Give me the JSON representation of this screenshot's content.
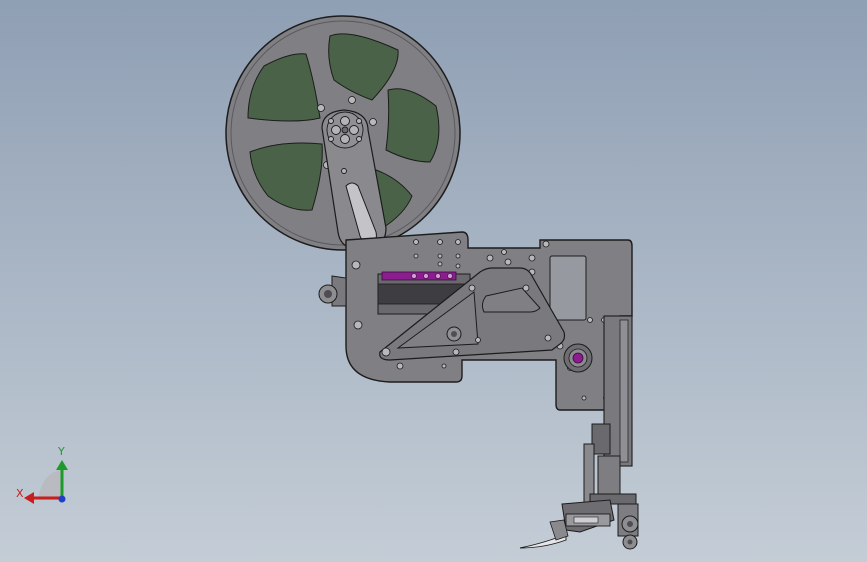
{
  "viewport": {
    "background_top": "#8f9fb4",
    "background_bottom": "#c4cdd6"
  },
  "model": {
    "part_color": "#808084",
    "edge_color": "#1c1c1c",
    "reel_window_color": "#4a6248",
    "highlight_color": "#8b1d8f"
  },
  "triad": {
    "x_label": "X",
    "y_label": "Y",
    "x_color": "#c81e1e",
    "y_color": "#1e9a2a",
    "z_color": "#1e3fc8"
  }
}
